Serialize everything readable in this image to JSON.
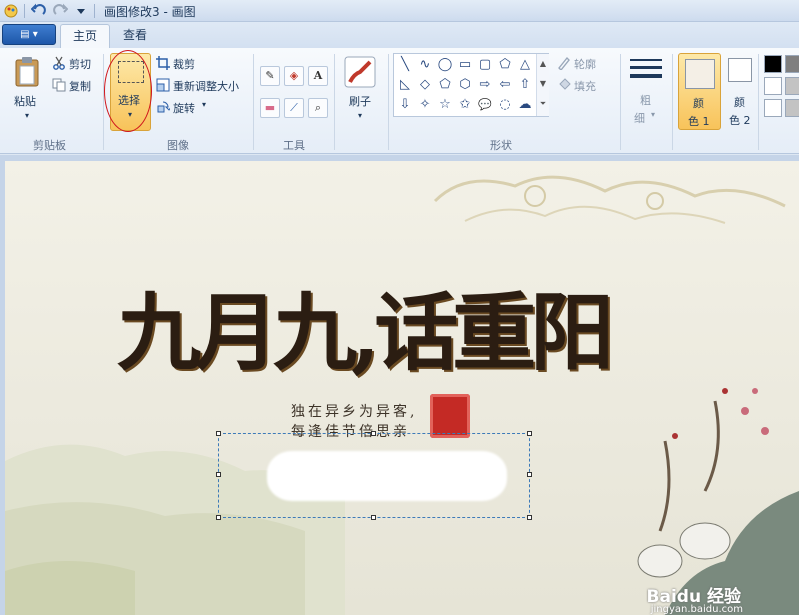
{
  "window": {
    "title": "画图修改3 - 画图"
  },
  "tabs": [
    {
      "label": "主页",
      "active": true
    },
    {
      "label": "查看",
      "active": false
    }
  ],
  "clipboard": {
    "paste_label": "粘贴",
    "cut_label": "剪切",
    "copy_label": "复制",
    "group_label": "剪贴板"
  },
  "image": {
    "select_label": "选择",
    "crop_label": "裁剪",
    "resize_label": "重新调整大小",
    "rotate_label": "旋转",
    "group_label": "图像"
  },
  "tools": {
    "group_label": "工具",
    "brush_label": "刷子"
  },
  "shapes": {
    "group_label": "形状",
    "outline_label": "轮廓",
    "fill_label": "填充",
    "glyphs": [
      "╲",
      "∿",
      "◯",
      "▭",
      "▢",
      "⬠",
      "△",
      "◺",
      "◇",
      "⬠",
      "⬡",
      "⇨",
      "⇦",
      "⇧",
      "⇩",
      "✧",
      "☆",
      "✩",
      "💬",
      "◌",
      "☁"
    ]
  },
  "size": {
    "label_line1": "粗",
    "label_line2": "细"
  },
  "colors": {
    "color1_line1": "颜",
    "color1_line2": "色 1",
    "color2_line1": "颜",
    "color2_line2": "色 2",
    "palette": [
      "#000000",
      "#7f7f7f",
      "#ffffff",
      "#c3c3c3",
      "#ffffff",
      "#c3c3c3"
    ],
    "color1": "#f4efe6",
    "color2": "#ffffff"
  },
  "canvas": {
    "headline": "九月九,话重阳",
    "poem_line1": "独在异乡为异客,",
    "poem_line2": "每逢佳节倍思亲",
    "watermark": "Baidu 经验",
    "watermark_url": "jingyan.baidu.com"
  }
}
